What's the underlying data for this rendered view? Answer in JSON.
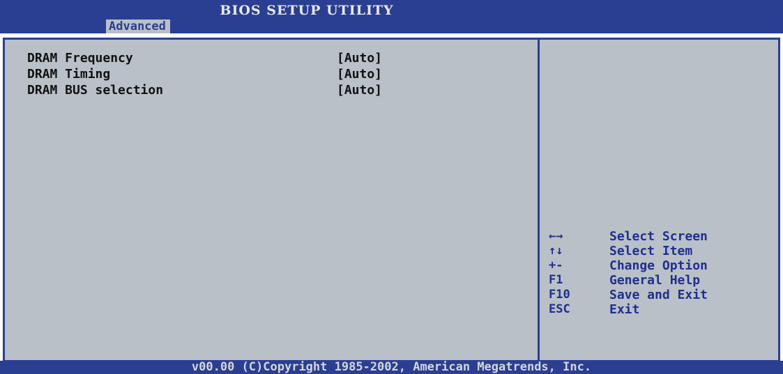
{
  "header": {
    "title": "BIOS SETUP UTILITY",
    "active_tab": "Advanced"
  },
  "settings": [
    {
      "label": "DRAM Frequency",
      "value": "[Auto]"
    },
    {
      "label": "DRAM Timing",
      "value": "[Auto]"
    },
    {
      "label": "DRAM BUS selection",
      "value": "[Auto]"
    }
  ],
  "help_keys": [
    {
      "key": "←→",
      "action": "Select Screen"
    },
    {
      "key": "↑↓",
      "action": "Select Item"
    },
    {
      "key": "+-",
      "action": "Change Option"
    },
    {
      "key": "F1",
      "action": "General Help"
    },
    {
      "key": "F10",
      "action": "Save and Exit"
    },
    {
      "key": "ESC",
      "action": "Exit"
    }
  ],
  "footer": {
    "copyright": "v00.00 (C)Copyright 1985-2002, American Megatrends, Inc."
  },
  "colors": {
    "bar_blue": "#2a3e92",
    "panel_gray": "#b9c0c7",
    "text_dark": "#111111",
    "help_blue": "#1f2f8e"
  }
}
